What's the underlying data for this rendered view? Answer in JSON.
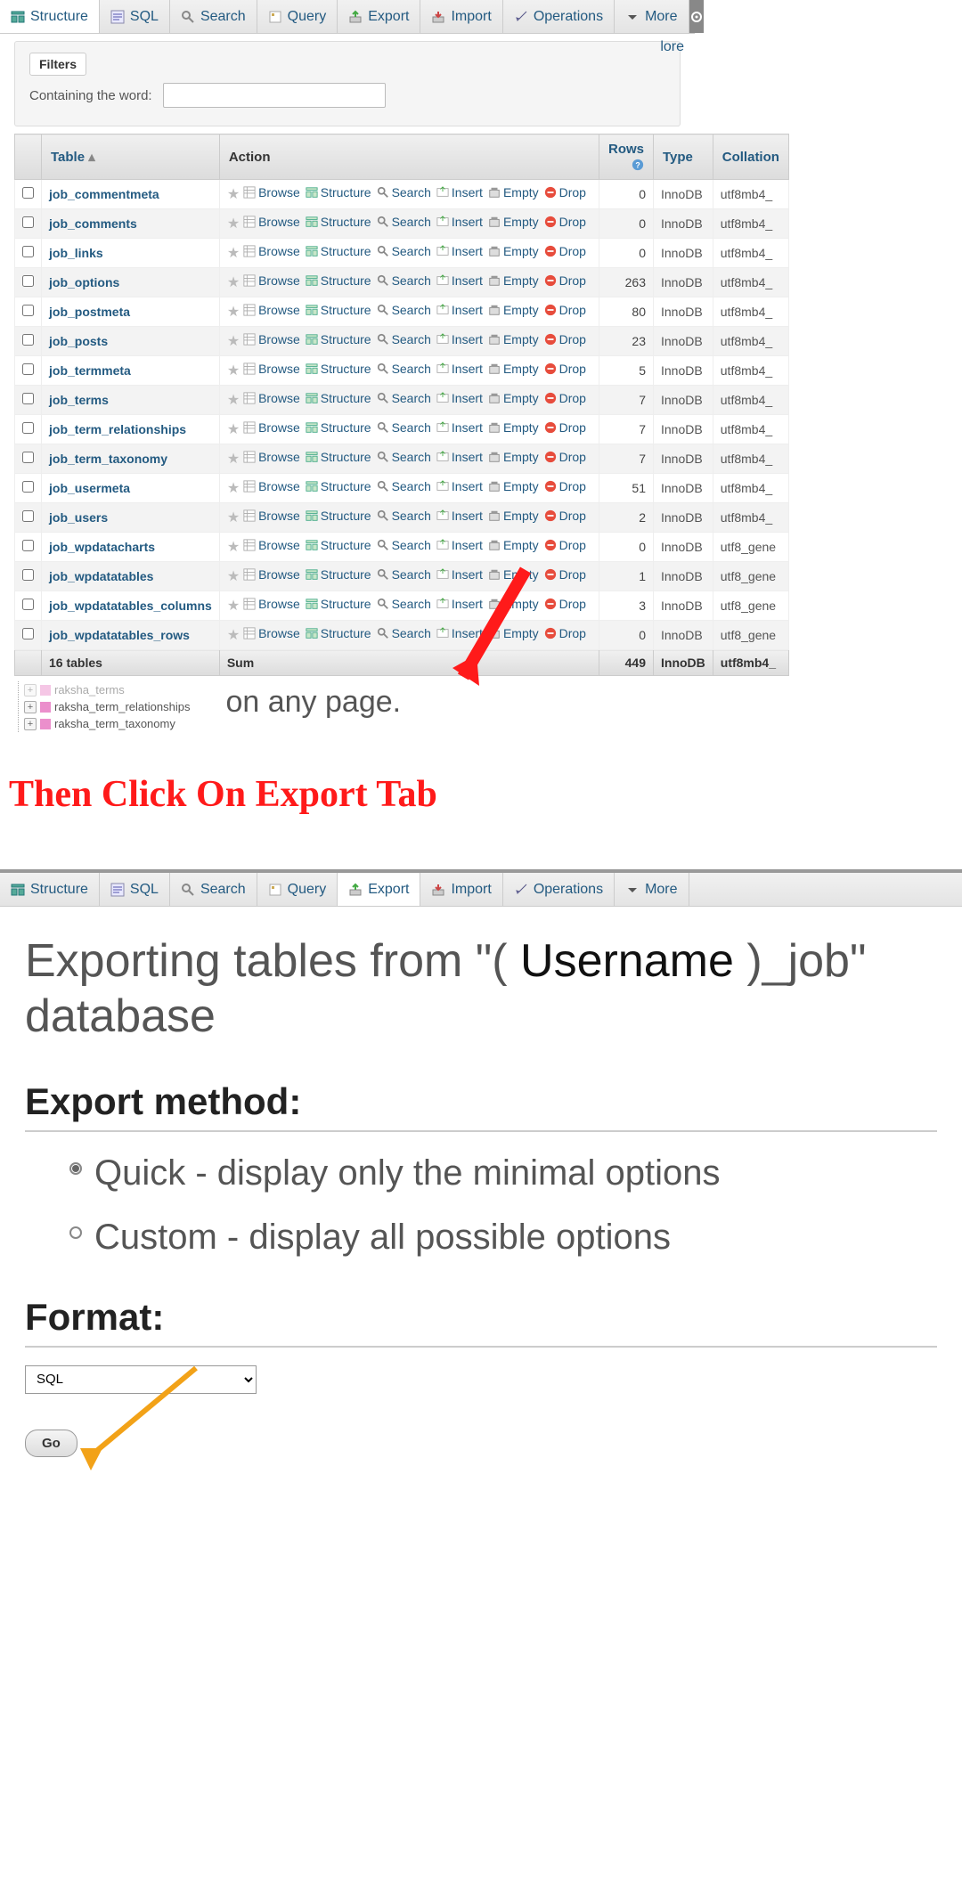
{
  "tabs1": [
    {
      "label": "Structure",
      "icon": "structure"
    },
    {
      "label": "SQL",
      "icon": "sql"
    },
    {
      "label": "Search",
      "icon": "search"
    },
    {
      "label": "Query",
      "icon": "query"
    },
    {
      "label": "Export",
      "icon": "export"
    },
    {
      "label": "Import",
      "icon": "import"
    },
    {
      "label": "Operations",
      "icon": "operations"
    },
    {
      "label": "More",
      "icon": "more"
    }
  ],
  "more_floating": "lore",
  "filters": {
    "tab_label": "Filters",
    "containing_label": "Containing the word:",
    "input_value": ""
  },
  "headers": {
    "table": "Table",
    "action": "Action",
    "rows": "Rows",
    "type": "Type",
    "collation": "Collation"
  },
  "actions": {
    "browse": "Browse",
    "structure": "Structure",
    "search": "Search",
    "insert": "Insert",
    "empty": "Empty",
    "drop": "Drop"
  },
  "rows": [
    {
      "name": "job_commentmeta",
      "rows": 0,
      "type": "InnoDB",
      "coll": "utf8mb4_"
    },
    {
      "name": "job_comments",
      "rows": 0,
      "type": "InnoDB",
      "coll": "utf8mb4_"
    },
    {
      "name": "job_links",
      "rows": 0,
      "type": "InnoDB",
      "coll": "utf8mb4_"
    },
    {
      "name": "job_options",
      "rows": 263,
      "type": "InnoDB",
      "coll": "utf8mb4_"
    },
    {
      "name": "job_postmeta",
      "rows": 80,
      "type": "InnoDB",
      "coll": "utf8mb4_"
    },
    {
      "name": "job_posts",
      "rows": 23,
      "type": "InnoDB",
      "coll": "utf8mb4_"
    },
    {
      "name": "job_termmeta",
      "rows": 5,
      "type": "InnoDB",
      "coll": "utf8mb4_"
    },
    {
      "name": "job_terms",
      "rows": 7,
      "type": "InnoDB",
      "coll": "utf8mb4_"
    },
    {
      "name": "job_term_relationships",
      "rows": 7,
      "type": "InnoDB",
      "coll": "utf8mb4_"
    },
    {
      "name": "job_term_taxonomy",
      "rows": 7,
      "type": "InnoDB",
      "coll": "utf8mb4_"
    },
    {
      "name": "job_usermeta",
      "rows": 51,
      "type": "InnoDB",
      "coll": "utf8mb4_"
    },
    {
      "name": "job_users",
      "rows": 2,
      "type": "InnoDB",
      "coll": "utf8mb4_"
    },
    {
      "name": "job_wpdatacharts",
      "rows": 0,
      "type": "InnoDB",
      "coll": "utf8_gene"
    },
    {
      "name": "job_wpdatatables",
      "rows": 1,
      "type": "InnoDB",
      "coll": "utf8_gene"
    },
    {
      "name": "job_wpdatatables_columns",
      "rows": 3,
      "type": "InnoDB",
      "coll": "utf8_gene"
    },
    {
      "name": "job_wpdatatables_rows",
      "rows": 0,
      "type": "InnoDB",
      "coll": "utf8_gene"
    }
  ],
  "summary": {
    "count_label": "16 tables",
    "sum_label": "Sum",
    "rows_total": 449,
    "type": "InnoDB",
    "coll": "utf8mb4_"
  },
  "tree": [
    "raksha_terms",
    "raksha_term_relationships",
    "raksha_term_taxonomy"
  ],
  "side_text": "on any page.",
  "annotation": "Then Click On Export Tab",
  "tabs2_active": "Export",
  "export": {
    "title_pre": "Exporting tables from \"(",
    "title_user": " Username ",
    "title_post": ")_job\" database",
    "method_label": "Export method:",
    "quick_label": "Quick - display only the minimal options",
    "custom_label": "Custom - display all possible options",
    "format_label": "Format:",
    "format_value": "SQL",
    "go_label": "Go"
  }
}
